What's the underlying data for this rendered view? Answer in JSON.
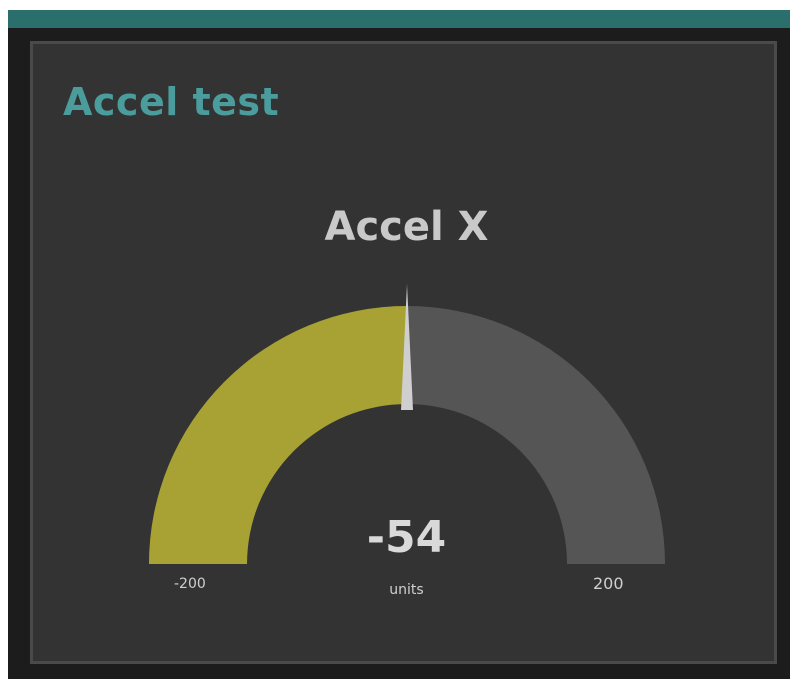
{
  "card": {
    "title": "Accel test"
  },
  "gauge": {
    "label": "Accel X",
    "value": -54,
    "value_text": "-54",
    "units": "units",
    "min": -200,
    "max": 200,
    "min_label": "-200",
    "max_label": "200",
    "needle_position": 0.5
  },
  "colors": {
    "top_bar": "#2b6f6c",
    "background": "#1c1c1c",
    "card_background": "#333333",
    "card_border": "#4a4a4a",
    "title": "#4b9c9c",
    "gauge_fill": "#a7a233",
    "gauge_track": "#555555",
    "needle": "#cfcfcf"
  }
}
